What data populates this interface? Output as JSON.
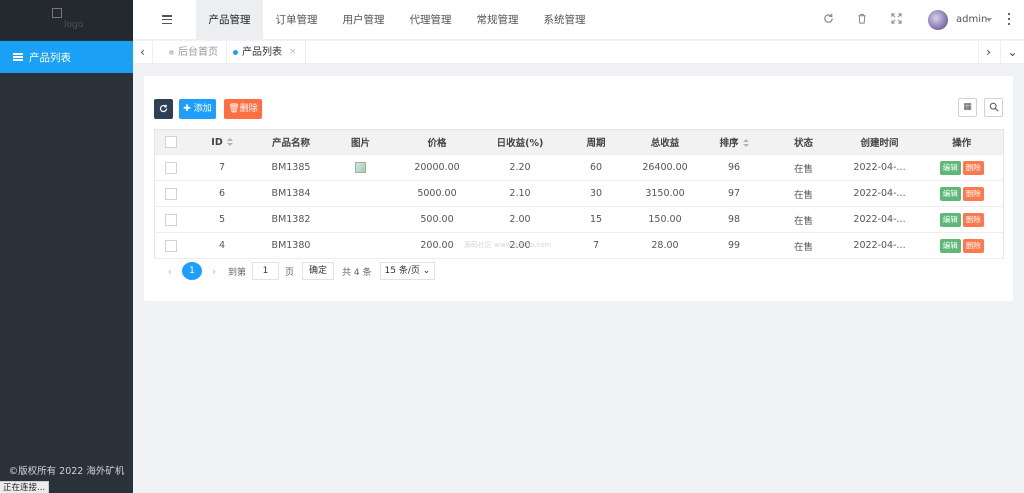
{
  "sidebar": {
    "logo_alt": "logo",
    "menu_items": [
      {
        "label": "产品列表",
        "icon": "list-icon"
      }
    ],
    "copyright": "©版权所有 2022 海外矿机",
    "status_tip": "正在连接..."
  },
  "header": {
    "tabs": [
      "产品管理",
      "订单管理",
      "用户管理",
      "代理管理",
      "常规管理",
      "系统管理"
    ],
    "active_tab": "产品管理",
    "username": "admin"
  },
  "tabbar": {
    "tabs": [
      {
        "label": "后台首页",
        "active": false
      },
      {
        "label": "产品列表",
        "active": true
      }
    ],
    "close_glyph": "×"
  },
  "toolbar": {
    "add_label": "添加",
    "delete_label": "删除"
  },
  "table": {
    "headers": [
      "ID",
      "产品名称",
      "图片",
      "价格",
      "日收益(%)",
      "周期",
      "总收益",
      "排序",
      "状态",
      "创建时间",
      "操作"
    ],
    "rows": [
      {
        "id": "7",
        "name": "BM1385",
        "has_image": true,
        "price": "20000.00",
        "daily": "2.20",
        "period": "60",
        "total": "26400.00",
        "sort": "96",
        "status": "在售",
        "created": "2022-04-..."
      },
      {
        "id": "6",
        "name": "BM1384",
        "has_image": false,
        "price": "5000.00",
        "daily": "2.10",
        "period": "30",
        "total": "3150.00",
        "sort": "97",
        "status": "在售",
        "created": "2022-04-..."
      },
      {
        "id": "5",
        "name": "BM1382",
        "has_image": false,
        "price": "500.00",
        "daily": "2.00",
        "period": "15",
        "total": "150.00",
        "sort": "98",
        "status": "在售",
        "created": "2022-04-..."
      },
      {
        "id": "4",
        "name": "BM1380",
        "has_image": false,
        "price": "200.00",
        "daily": "2.00",
        "period": "7",
        "total": "28.00",
        "sort": "99",
        "status": "在售",
        "created": "2022-04-..."
      }
    ],
    "row_actions": {
      "edit": "编辑",
      "delete": "删除"
    }
  },
  "watermark": "源码社区 www.ecbba.com",
  "pagination": {
    "current": "1",
    "goto_label": "到第",
    "goto_value": "1",
    "page_unit": "页",
    "confirm": "确定",
    "total": "共 4 条",
    "page_size": "15 条/页"
  },
  "colors": {
    "sidebar_bg": "#2a313a",
    "accent": "#1e9fff",
    "danger": "#ff5722",
    "edit": "#5fb878"
  }
}
